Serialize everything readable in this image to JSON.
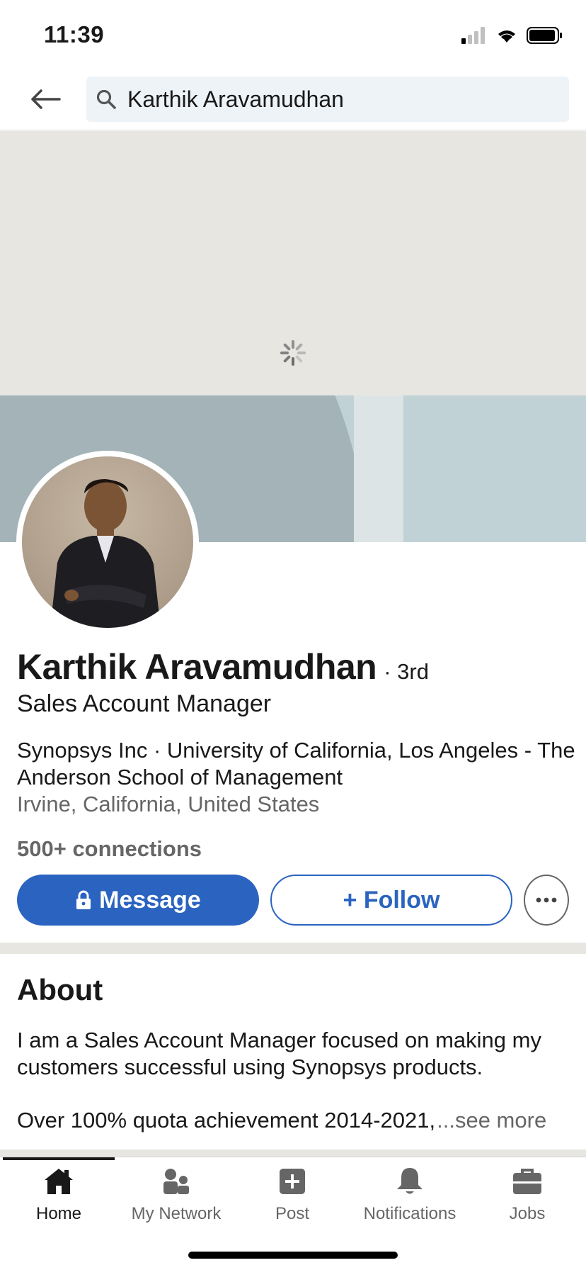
{
  "status_bar": {
    "time": "11:39"
  },
  "search": {
    "query": "Karthik Aravamudhan"
  },
  "profile": {
    "name": "Karthik Aravamudhan",
    "degree": "· 3rd",
    "headline": "Sales Account Manager",
    "org": "Synopsys Inc · University of California, Los Angeles - The Anderson School of Management",
    "location": "Irvine, California, United States",
    "connections": "500+ connections"
  },
  "actions": {
    "message_label": "Message",
    "follow_label": "+ Follow"
  },
  "about": {
    "title": "About",
    "text": "I am a Sales Account Manager focused on making my customers successful using Synopsys products.",
    "line3": "Over 100% quota achievement 2014-2021,",
    "see_more": "...see more"
  },
  "tabs": [
    {
      "label": "Home",
      "icon": "home-icon",
      "active": true
    },
    {
      "label": "My Network",
      "icon": "my-network-icon",
      "active": false
    },
    {
      "label": "Post",
      "icon": "post-icon",
      "active": false
    },
    {
      "label": "Notifications",
      "icon": "notifications-icon",
      "active": false
    },
    {
      "label": "Jobs",
      "icon": "jobs-icon",
      "active": false
    }
  ],
  "colors": {
    "primary": "#2b64c0",
    "muted": "#666666",
    "text": "#191919",
    "cover": "#e8e6e1"
  }
}
